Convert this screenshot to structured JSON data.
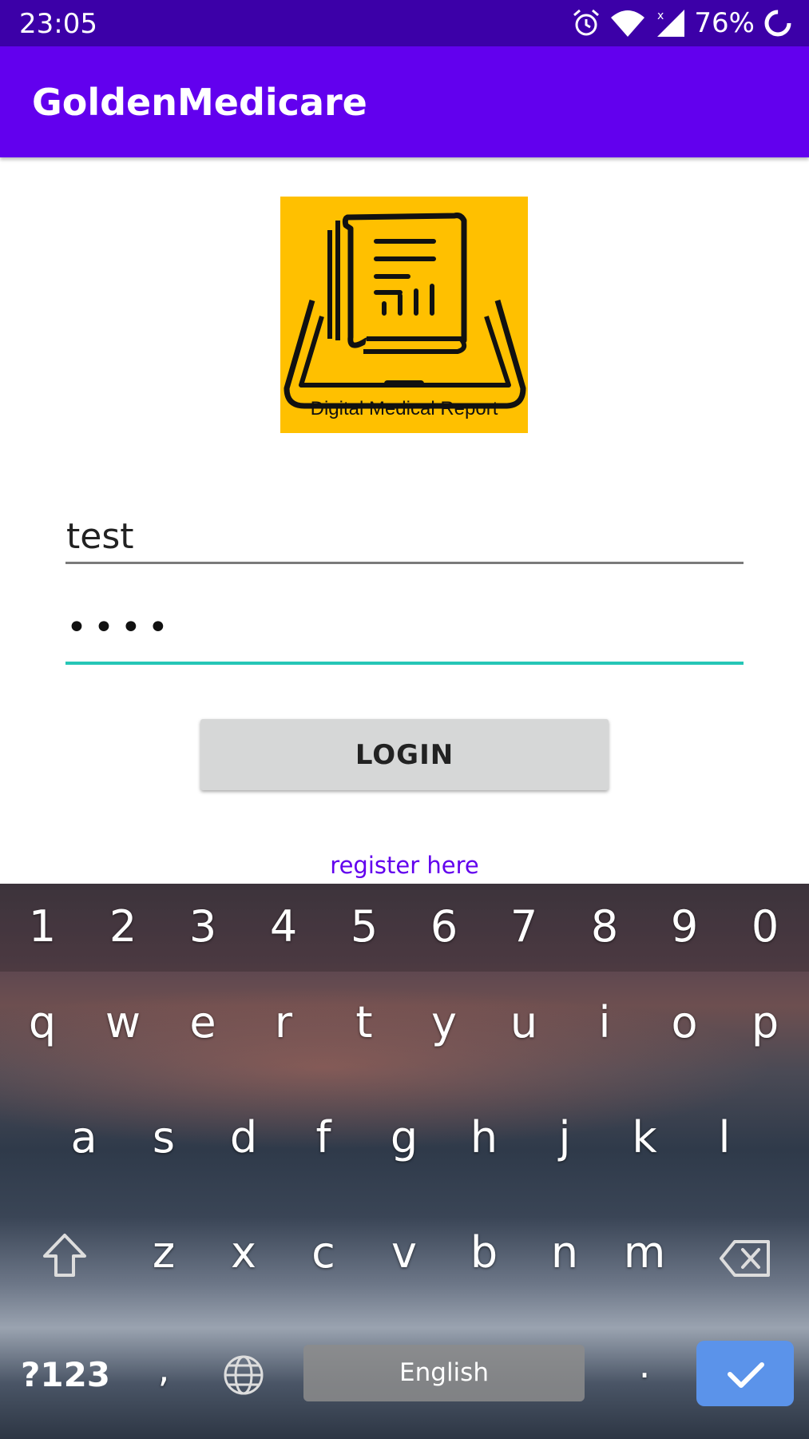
{
  "status_bar": {
    "time": "23:05",
    "battery_percent": "76%",
    "icons": [
      "alarm-icon",
      "wifi-icon",
      "signal-no-data-icon",
      "battery-ring-icon"
    ]
  },
  "app_bar": {
    "title": "GoldenMedicare"
  },
  "logo": {
    "caption": "Digital Medical Report",
    "background": "#ffc000"
  },
  "form": {
    "username_value": "test",
    "password_value": "••••",
    "login_label": "LOGIN",
    "register_label": "register here"
  },
  "keyboard": {
    "number_row": [
      "1",
      "2",
      "3",
      "4",
      "5",
      "6",
      "7",
      "8",
      "9",
      "0"
    ],
    "row1": [
      "q",
      "w",
      "e",
      "r",
      "t",
      "y",
      "u",
      "i",
      "o",
      "p"
    ],
    "row2": [
      "a",
      "s",
      "d",
      "f",
      "g",
      "h",
      "j",
      "k",
      "l"
    ],
    "row3": [
      "z",
      "x",
      "c",
      "v",
      "b",
      "n",
      "m"
    ],
    "symbols_label": "?123",
    "comma": ",",
    "space_label": "English",
    "period": "."
  },
  "colors": {
    "status_bar": "#3c00a8",
    "app_bar": "#6200ee",
    "focus_underline": "#26c6b6",
    "link": "#6200ee",
    "enter_key": "#5b93ea"
  }
}
